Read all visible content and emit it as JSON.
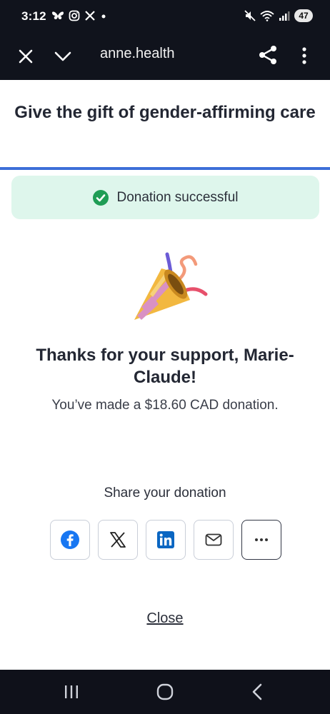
{
  "status_bar": {
    "time": "3:12",
    "battery": "47",
    "icons_left": [
      "butterfly-icon",
      "instagram-icon",
      "x-icon",
      "dot-icon"
    ],
    "icons_right": [
      "mute-icon",
      "wifi-icon",
      "signal-icon",
      "battery-icon"
    ]
  },
  "browser": {
    "url": "anne.health",
    "icons": [
      "close-icon",
      "chevron-down-icon",
      "share-icon",
      "more-vertical-icon"
    ]
  },
  "page": {
    "title": "Give the gift of gender-affirming care",
    "success_message": "Donation successful",
    "thanks_title": "Thanks for your support, Marie-Claude!",
    "donation_text": "You’ve made a $18.60 CAD donation.",
    "share_heading": "Share your donation",
    "share_buttons": [
      "facebook-icon",
      "x-icon",
      "linkedin-icon",
      "email-icon",
      "more-icon"
    ],
    "close_label": "Close"
  },
  "colors": {
    "accent_blue": "#3d6fd8",
    "success_bg": "#def6ec",
    "success_green": "#1f9d55",
    "dark_bar": "#10131c"
  }
}
